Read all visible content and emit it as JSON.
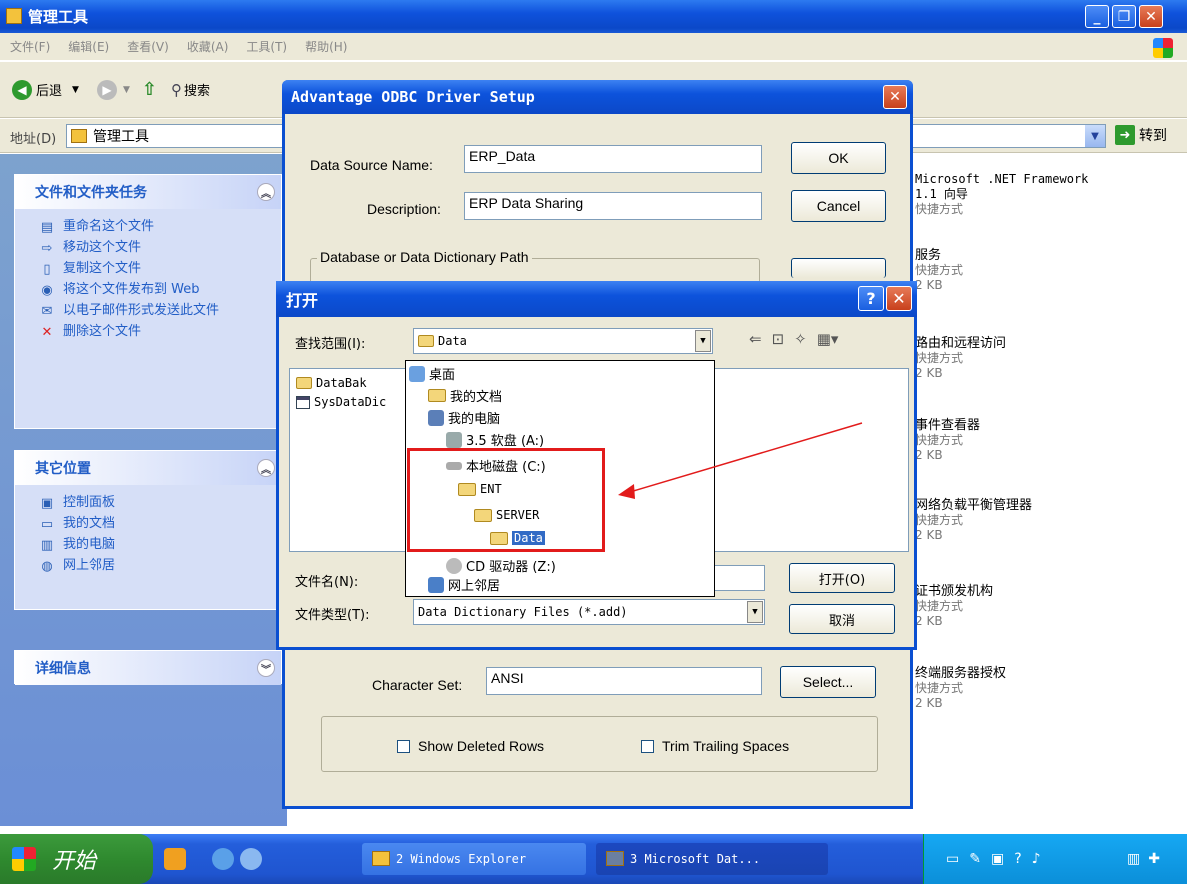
{
  "window": {
    "title": "管理工具",
    "menu": [
      "文件(F)",
      "编辑(E)",
      "查看(V)",
      "收藏(A)",
      "工具(T)",
      "帮助(H)"
    ],
    "toolbar": {
      "back": "后退",
      "search": "搜索"
    },
    "address_label": "地址(D)",
    "address_value": "管理工具",
    "go_label": "转到"
  },
  "leftpane": {
    "tasks_title": "文件和文件夹任务",
    "tasks": [
      "重命名这个文件",
      "移动这个文件",
      "复制这个文件",
      "将这个文件发布到 Web",
      "以电子邮件形式发送此文件",
      "删除这个文件"
    ],
    "places_title": "其它位置",
    "places": [
      "控制面板",
      "我的文档",
      "我的电脑",
      "网上邻居"
    ],
    "details_title": "详细信息"
  },
  "rightpane": {
    "items": [
      {
        "name": "Microsoft .NET Framework 1.1 向导",
        "type": "快捷方式",
        "size": ""
      },
      {
        "name": "服务",
        "type": "快捷方式",
        "size": "2 KB"
      },
      {
        "name": "路由和远程访问",
        "type": "快捷方式",
        "size": "2 KB"
      },
      {
        "name": "事件查看器",
        "type": "快捷方式",
        "size": "2 KB"
      },
      {
        "name": "网络负载平衡管理器",
        "type": "快捷方式",
        "size": "2 KB"
      },
      {
        "name": "证书颁发机构",
        "type": "快捷方式",
        "size": "2 KB"
      },
      {
        "name": "终端服务器授权",
        "type": "快捷方式",
        "size": "2 KB"
      }
    ]
  },
  "odbc": {
    "title": "Advantage ODBC Driver Setup",
    "dsn_label": "Data Source Name:",
    "dsn_value": "ERP_Data",
    "desc_label": "Description:",
    "desc_value": "ERP Data Sharing",
    "ok": "OK",
    "cancel": "Cancel",
    "db_group": "Database or Data Dictionary Path",
    "charset_label": "Character Set:",
    "charset_value": "ANSI",
    "select": "Select...",
    "show_deleted": "Show Deleted Rows",
    "trim_spaces": "Trim Trailing Spaces"
  },
  "open": {
    "title": "打开",
    "lookin_label": "查找范围(I):",
    "lookin_value": "Data",
    "files": [
      "DataBak",
      "SysDataDic"
    ],
    "filename_label": "文件名(N):",
    "filetype_label": "文件类型(T):",
    "filetype_value": "Data Dictionary Files (*.add)",
    "open_btn": "打开(O)",
    "cancel_btn": "取消",
    "dropdown": [
      "桌面",
      "我的文档",
      "我的电脑",
      "3.5 软盘 (A:)",
      "本地磁盘 (C:)",
      "ENT",
      "SERVER",
      "Data",
      "CD 驱动器 (Z:)",
      "网上邻居"
    ]
  },
  "taskbar": {
    "start": "开始",
    "tasks": [
      "2 Windows Explorer",
      "3 Microsoft Dat..."
    ]
  },
  "colors": {
    "accent": "#0a4fd1",
    "highlight": "#e21b1b"
  }
}
